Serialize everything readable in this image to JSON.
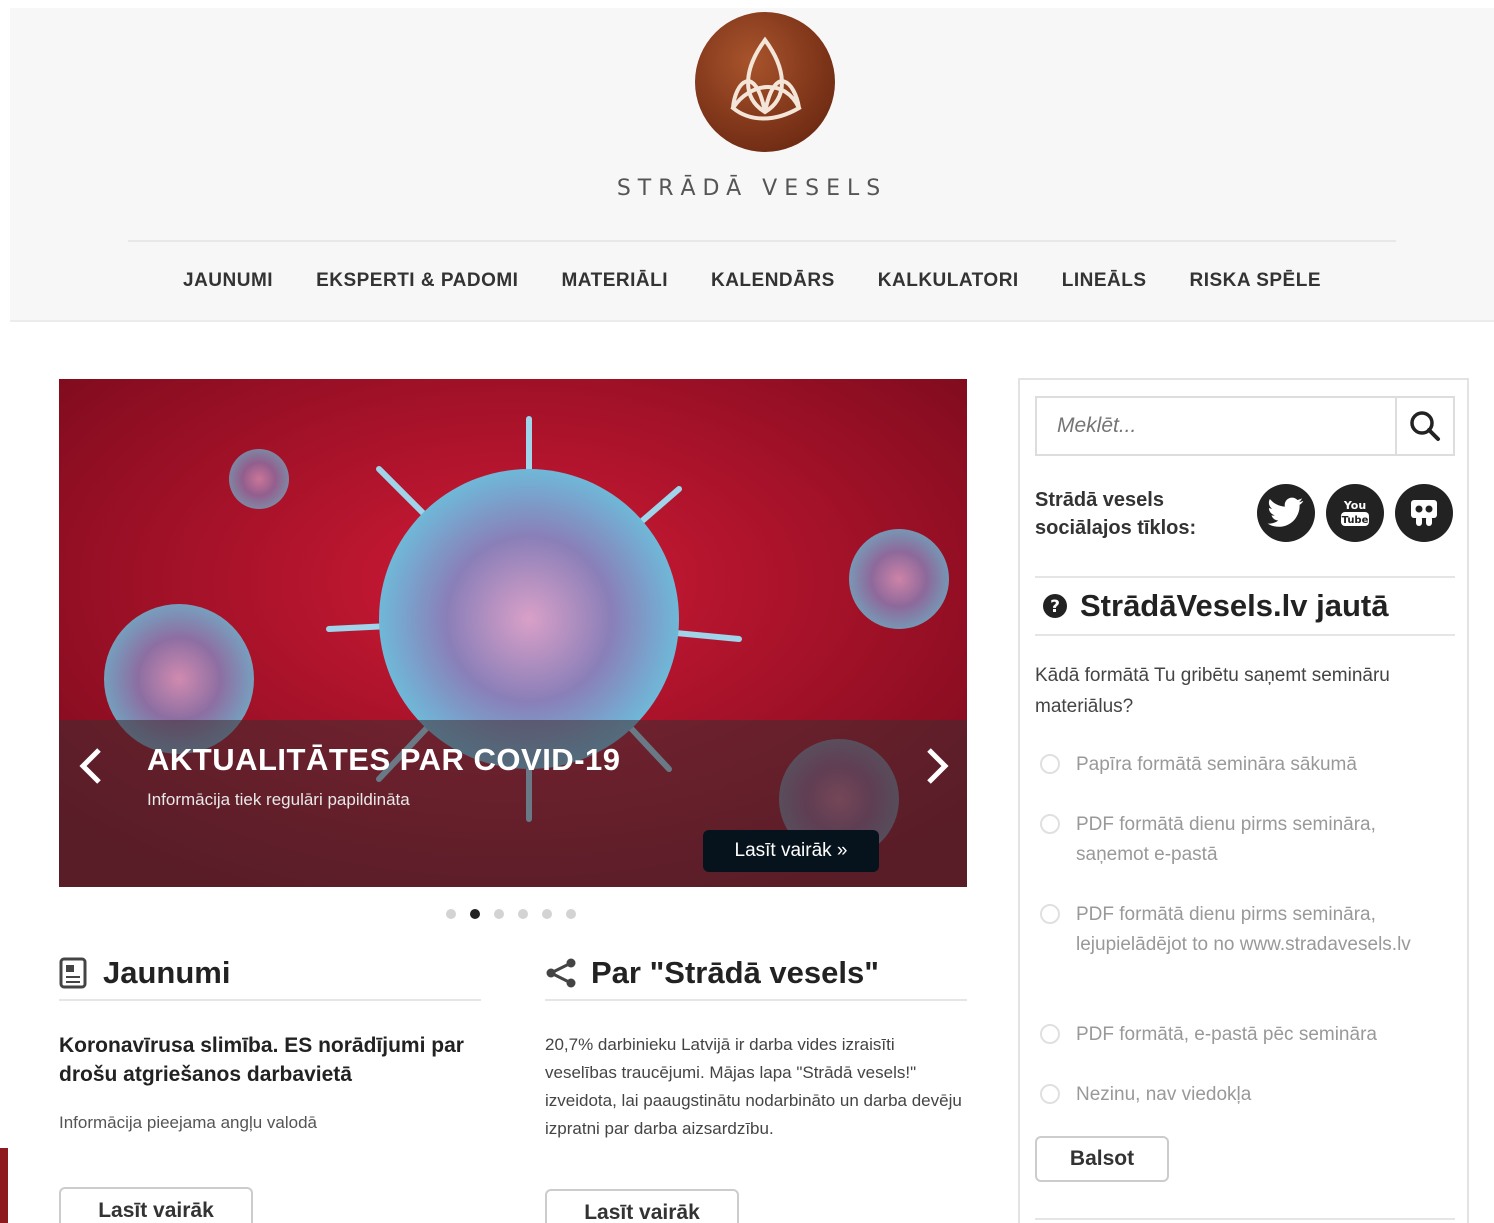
{
  "site": {
    "brand": "STRĀDĀ VESELS"
  },
  "nav": [
    "JAUNUMI",
    "EKSPERTI & PADOMI",
    "MATERIĀLI",
    "KALENDĀRS",
    "KALKULATORI",
    "LINEĀLS",
    "RISKA SPĒLE"
  ],
  "slider": {
    "title": "AKTUALITĀTES PAR COVID-19",
    "subtitle": "Informācija tiek regulāri papildināta",
    "read_more": "Lasīt vairāk »",
    "slide_count": 6,
    "active_slide": 2
  },
  "news": {
    "heading": "Jaunumi",
    "headline": "Koronavīrusa slimība. ES norādījumi par drošu atgriešanos darbavietā",
    "info": "Informācija pieejama angļu valodā",
    "button": "Lasīt vairāk"
  },
  "about": {
    "heading": "Par \"Strādā vesels\"",
    "body": "20,7% darbinieku Latvijā ir darba vides izraisīti veselības traucējumi. Mājas lapa \"Strādā vesels!\" izveidota, lai paaugstinātu nodarbināto un darba devēju izpratni par darba aizsardzību.",
    "button": "Lasīt vairāk"
  },
  "sidebar": {
    "search_placeholder": "Meklēt...",
    "social_label_1": "Strādā vesels",
    "social_label_2": "sociālajos tīklos:",
    "social": [
      "twitter-icon",
      "youtube-icon",
      "slideshare-icon"
    ],
    "poll_title": "StrādāVesels.lv jautā",
    "question": "Kādā formātā Tu gribētu saņemt semināru materiālus?",
    "options": [
      "Papīra formātā semināra sākumā",
      "PDF formātā dienu pirms semināra, saņemot e-pastā",
      "PDF formātā dienu pirms semināra, lejupielādējot to no www.stradavesels.lv",
      "PDF formātā, e-pastā pēc semināra",
      "Nezinu, nav viedokļa"
    ],
    "vote_button": "Balsot"
  },
  "colors": {
    "slider_red": "#b3122b",
    "logo_brown": "#80361a",
    "button_dark": "#07131c"
  }
}
